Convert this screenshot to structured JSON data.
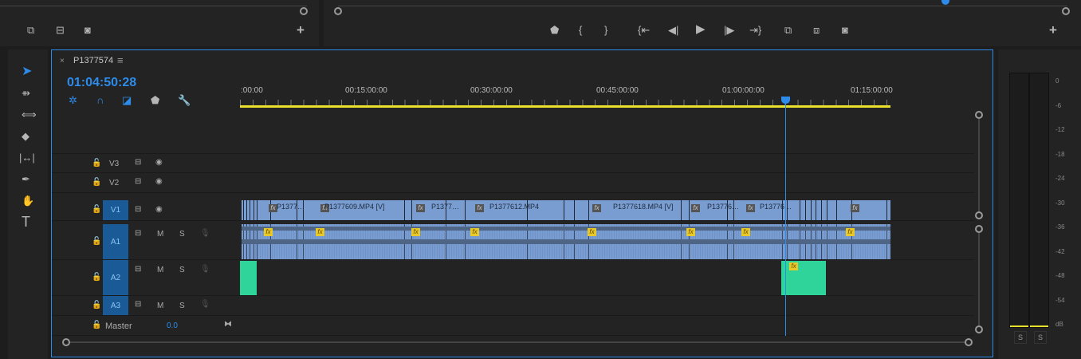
{
  "source_monitor": {
    "buttons": [
      "insert-icon",
      "overwrite-icon",
      "export-frame-icon",
      "add-icon"
    ]
  },
  "program_monitor": {
    "buttons": [
      "marker",
      "mark-in",
      "mark-out",
      "go-to-in",
      "step-back",
      "play",
      "step-forward",
      "go-to-out",
      "lift",
      "extract",
      "export-frame",
      "add"
    ]
  },
  "tools": [
    "selection",
    "track-select",
    "ripple-edit",
    "razor",
    "slip",
    "pen",
    "hand",
    "type"
  ],
  "sequence": {
    "name": "P1377574",
    "timecode": "01:04:50:28"
  },
  "ruler": {
    "labels": [
      ":00:00",
      "00:15:00:00",
      "00:30:00:00",
      "00:45:00:00",
      "01:00:00:00",
      "01:15:00:00"
    ]
  },
  "tracks": {
    "video": [
      {
        "name": "V3"
      },
      {
        "name": "V2"
      },
      {
        "name": "V1"
      }
    ],
    "audio": [
      {
        "name": "A1",
        "m": "M",
        "s": "S"
      },
      {
        "name": "A2",
        "m": "M",
        "s": "S"
      },
      {
        "name": "A3",
        "m": "M",
        "s": "S"
      }
    ],
    "master": {
      "name": "Master",
      "value": "0.0"
    }
  },
  "clips": {
    "v1": [
      "P1377…",
      "P1377609.MP4 [V]",
      "P1377…",
      "P1377612.MP4",
      "P1377618.MP4 [V]",
      "P13776…",
      "P13776…"
    ],
    "fx": "fx"
  },
  "meter": {
    "scale": [
      "0",
      "-6",
      "-12",
      "-18",
      "-24",
      "-30",
      "-36",
      "-42",
      "-48",
      "-54",
      "dB"
    ],
    "solo": [
      "S",
      "S"
    ]
  },
  "colors": {
    "accent": "#2d8ceb",
    "clip_video": "#7a9dd1",
    "clip_audio_a2": "#2fd49a",
    "ruler": "#e8e02a"
  }
}
